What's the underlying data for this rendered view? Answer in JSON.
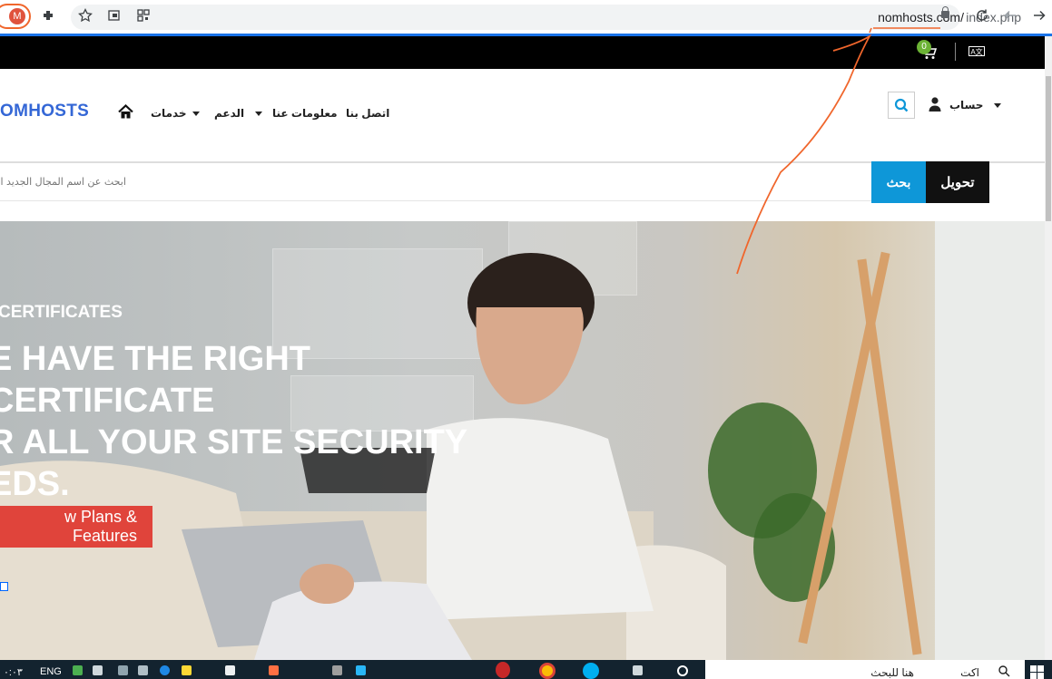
{
  "browser": {
    "profile_initial": "M",
    "url_domain": "nomhosts.com/",
    "url_path": "index.php"
  },
  "topbar": {
    "cart_count": "0"
  },
  "nav": {
    "logo": "OMHOSTS",
    "items": [
      "خدمات",
      "الدعم",
      "معلومات عنا",
      "اتصل بنا"
    ],
    "account": "حساب"
  },
  "domain_search": {
    "placeholder": "ابحث عن اسم المجال الجديد الخ",
    "search_label": "بحث",
    "transfer_label": "تحويل"
  },
  "hero": {
    "eyebrow": "CERTIFICATES",
    "title_line1": "E HAVE THE RIGHT CERTIFICATE",
    "title_line2": "R ALL YOUR SITE SECURITY",
    "title_line3": "EDS.",
    "cta": "w Plans & Features"
  },
  "taskbar": {
    "clock": "٠:٠٣",
    "lang": "ENG",
    "search_text": "هنا للبحث",
    "search_text2": "اكت"
  },
  "colors": {
    "accent_blue": "#0e97d8",
    "logo_blue": "#3467d6",
    "cta_red": "#e0443b",
    "annotation": "#f0662c"
  }
}
